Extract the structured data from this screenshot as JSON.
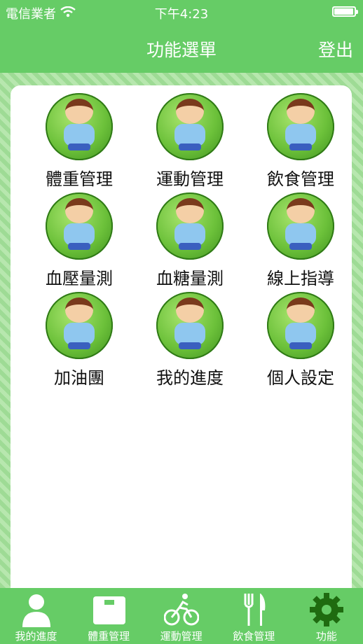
{
  "status_bar": {
    "carrier": "電信業者",
    "time": "下午4:23",
    "battery_level": 0.95
  },
  "nav": {
    "title": "功能選單",
    "logout_label": "登出"
  },
  "menu": {
    "items": [
      {
        "label": "體重管理",
        "icon": "weight-scale-icon"
      },
      {
        "label": "運動管理",
        "icon": "treadmill-icon"
      },
      {
        "label": "飲食管理",
        "icon": "meal-icon"
      },
      {
        "label": "血壓量測",
        "icon": "blood-pressure-icon"
      },
      {
        "label": "血糖量測",
        "icon": "blood-sugar-icon"
      },
      {
        "label": "線上指導",
        "icon": "online-guidance-icon"
      },
      {
        "label": "加油團",
        "icon": "cheer-icon"
      },
      {
        "label": "我的進度",
        "icon": "progress-chart-icon"
      },
      {
        "label": "個人設定",
        "icon": "wrench-settings-icon"
      }
    ]
  },
  "tabbar": {
    "items": [
      {
        "label": "我的進度",
        "icon": "person-icon"
      },
      {
        "label": "體重管理",
        "icon": "scale-icon"
      },
      {
        "label": "運動管理",
        "icon": "cyclist-icon"
      },
      {
        "label": "飲食管理",
        "icon": "fork-knife-icon"
      },
      {
        "label": "功能",
        "icon": "gear-icon"
      }
    ],
    "active_index": 4
  },
  "colors": {
    "primary_green": "#66cc66",
    "stripe_light": "#b7e7ae",
    "active_tab_icon": "#1f6b10"
  }
}
